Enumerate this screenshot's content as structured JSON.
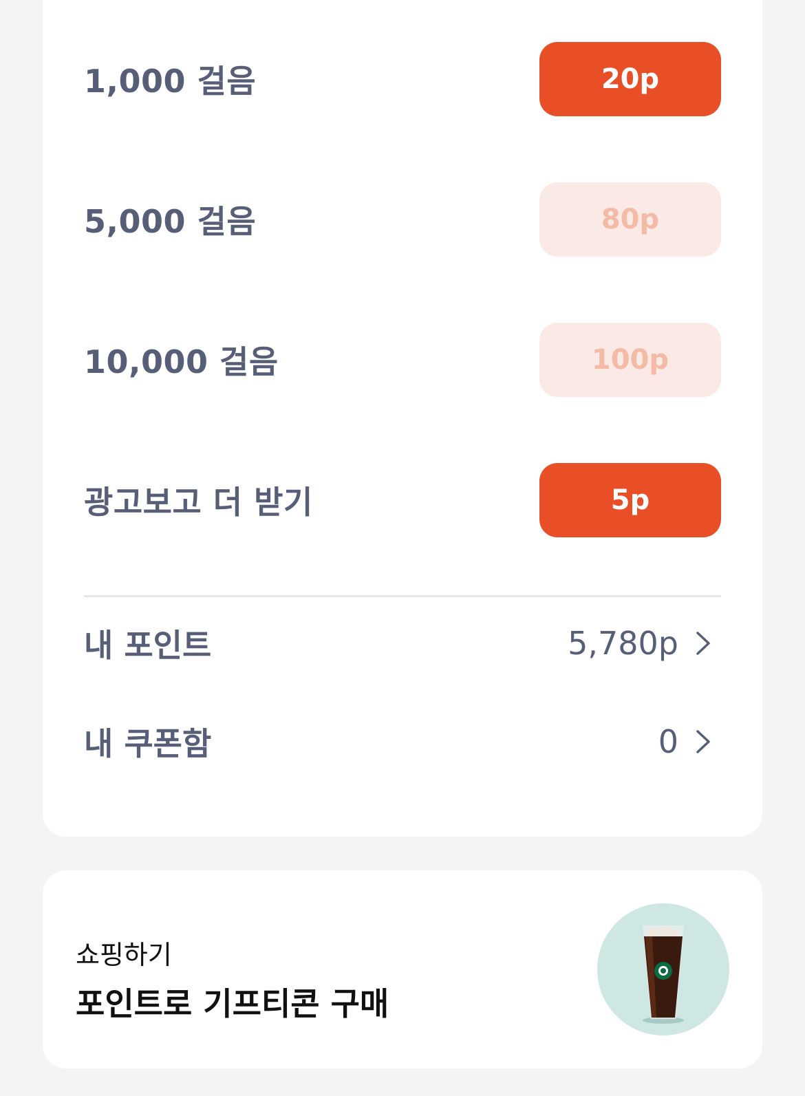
{
  "rewards": [
    {
      "label": "1,000 걸음",
      "points": "20p",
      "state": "active"
    },
    {
      "label": "5,000 걸음",
      "points": "80p",
      "state": "disabled"
    },
    {
      "label": "10,000 걸음",
      "points": "100p",
      "state": "disabled"
    },
    {
      "label": "광고보고 더 받기",
      "points": "5p",
      "state": "active"
    }
  ],
  "my_points": {
    "label": "내 포인트",
    "value": "5,780p"
  },
  "my_coupons": {
    "label": "내 쿠폰함",
    "value": "0"
  },
  "shop": {
    "caption": "쇼핑하기",
    "title": "포인트로 기프티콘 구매"
  },
  "colors": {
    "accent": "#e84f26",
    "accent_disabled_bg": "#fae9e4",
    "accent_disabled_text": "#f3baa6",
    "label_text": "#575e78",
    "page_bg": "#f3f4f6",
    "thumb_bg": "#cfe7e3"
  },
  "icons": {
    "chevron": "chevron-right-icon",
    "product": "iced-coffee-icon"
  }
}
